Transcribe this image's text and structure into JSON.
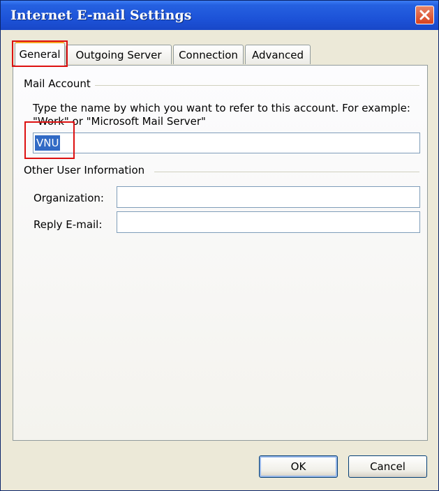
{
  "window": {
    "title": "Internet E-mail Settings",
    "close_icon": "close-icon"
  },
  "tabs": [
    {
      "label": "General",
      "active": true
    },
    {
      "label": "Outgoing Server",
      "active": false
    },
    {
      "label": "Connection",
      "active": false
    },
    {
      "label": "Advanced",
      "active": false
    }
  ],
  "mail_account": {
    "group_label": "Mail Account",
    "description": "Type the name by which you want to refer to this account. For example: \"Work\" or \"Microsoft Mail Server\"",
    "name_value": "VNU"
  },
  "other_info": {
    "group_label": "Other User Information",
    "organization_label": "Organization:",
    "organization_value": "",
    "reply_email_label": "Reply E-mail:",
    "reply_email_value": ""
  },
  "buttons": {
    "ok_label": "OK",
    "cancel_label": "Cancel"
  },
  "colors": {
    "titlebar": "#1d53d8",
    "highlight_box": "#dd1010",
    "selection": "#316ac5"
  }
}
